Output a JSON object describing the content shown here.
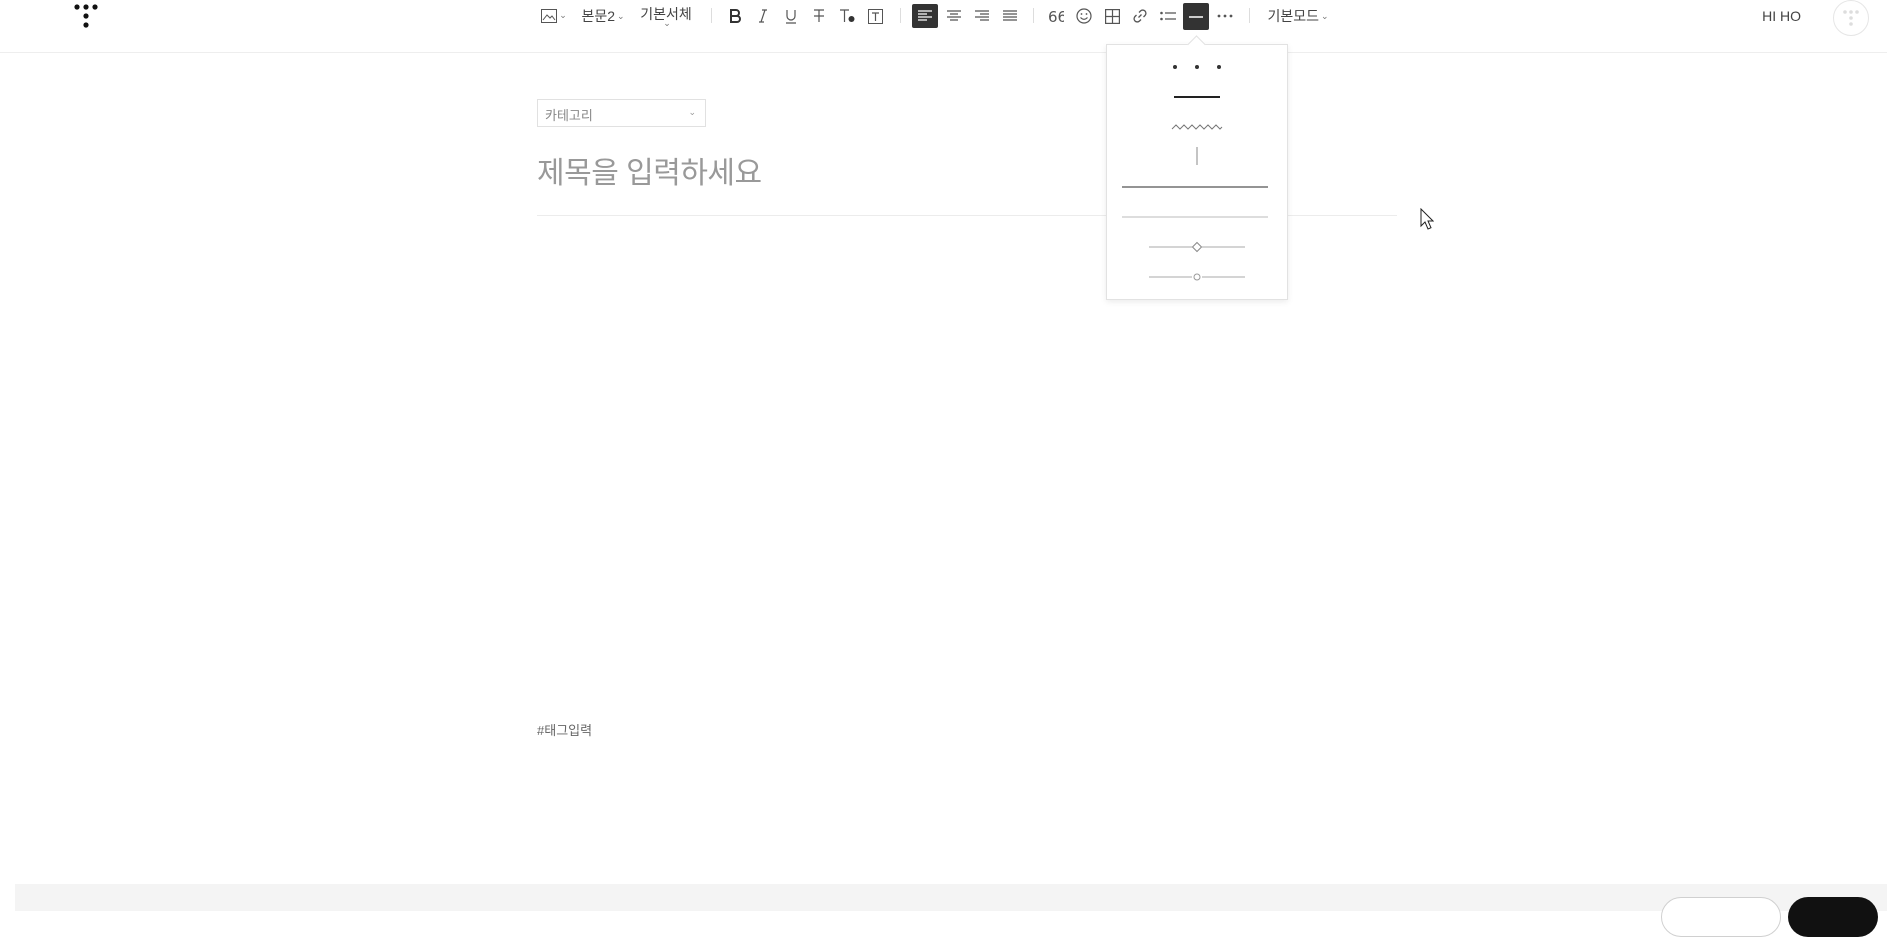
{
  "toolbar": {
    "paragraph_style": "본문2",
    "font_family": "기본서체",
    "mode": "기본모드"
  },
  "user": {
    "name": "HI HO"
  },
  "editor": {
    "category_placeholder": "카테고리",
    "title_placeholder": "제목을 입력하세요",
    "tag_placeholder": "#태그입력"
  },
  "divider_menu": {
    "options": [
      "dots",
      "short-line",
      "zigzag",
      "vertical-line",
      "long-line",
      "thin-long-line",
      "line-diamond",
      "line-circle"
    ]
  },
  "icons": [
    "logo-icon",
    "image-icon",
    "bold-icon",
    "italic-icon",
    "underline-icon",
    "strikethrough-icon",
    "text-color-icon",
    "text-background-icon",
    "align-left-icon",
    "align-center-icon",
    "align-right-icon",
    "align-justify-icon",
    "quote-icon",
    "emoji-icon",
    "table-icon",
    "link-icon",
    "list-icon",
    "divider-icon",
    "more-icon",
    "mouse-cursor-icon"
  ],
  "colors": {
    "active": "#333333",
    "text": "#555555",
    "placeholder": "#999999"
  }
}
